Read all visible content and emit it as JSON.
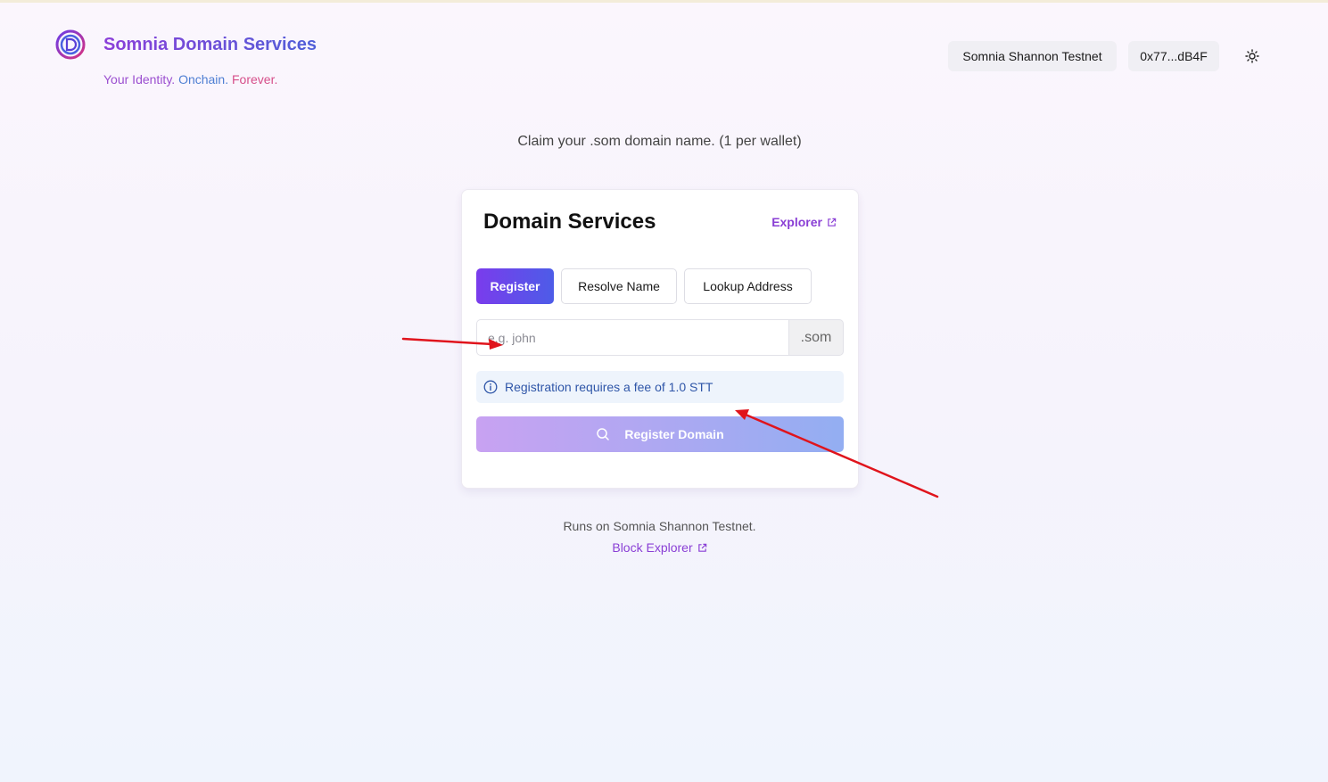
{
  "header": {
    "brand_title": "Somnia Domain Services",
    "tagline": {
      "part1": "Your Identity.",
      "part2": "Onchain.",
      "part3": "Forever."
    },
    "network_label": "Somnia Shannon Testnet",
    "wallet_label": "0x77...dB4F",
    "theme_icon": "sun-icon"
  },
  "intro": {
    "claim_text": "Claim your .som domain name. (1 per wallet)"
  },
  "card": {
    "title": "Domain Services",
    "explorer_link": "Explorer",
    "tabs": [
      {
        "label": "Register",
        "active": true
      },
      {
        "label": "Resolve Name",
        "active": false
      },
      {
        "label": "Lookup Address",
        "active": false
      }
    ],
    "domain_input": {
      "value": "",
      "placeholder": "e.g. john",
      "suffix": ".som"
    },
    "fee_notice": "Registration requires a fee of 1.0 STT",
    "register_button": "Register Domain"
  },
  "footer": {
    "runs_on": "Runs on Somnia Shannon Testnet.",
    "block_explorer": "Block Explorer"
  },
  "colors": {
    "accent_purple": "#8a3fd5",
    "accent_blue": "#4d5ce8",
    "annotation_red": "#e0141c",
    "info_text": "#2f56a8"
  }
}
